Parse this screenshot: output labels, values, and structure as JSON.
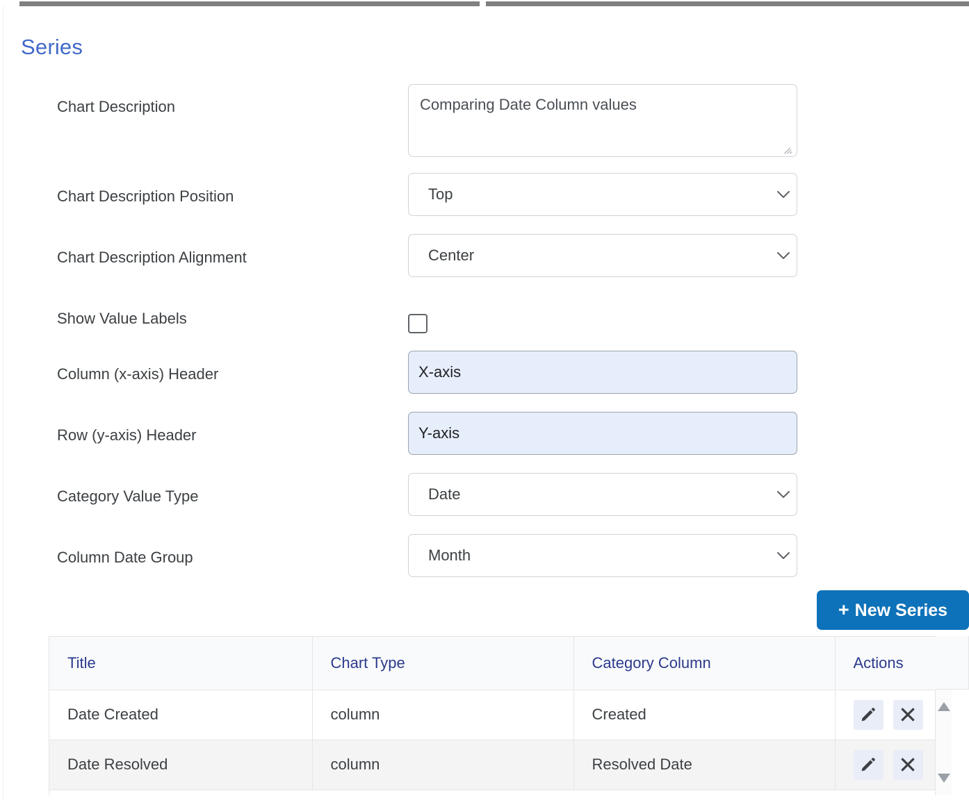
{
  "window": {
    "top_scrollbar": "horizontal-scrollbar"
  },
  "section": {
    "title": "Series",
    "title_color": "#4169c8"
  },
  "form": {
    "rows": [
      {
        "label": "Chart Description",
        "control": "textarea",
        "value": "Comparing Date Column values"
      },
      {
        "label": "Chart Description Position",
        "control": "select",
        "value": "Top"
      },
      {
        "label": "Chart Description Alignment",
        "control": "select",
        "value": "Center"
      },
      {
        "label": "Show Value Labels",
        "control": "checkbox",
        "value": "unchecked"
      },
      {
        "label": "Column (x-axis) Header",
        "control": "text",
        "value": "X-axis"
      },
      {
        "label": "Row (y-axis) Header",
        "control": "text",
        "value": "Y-axis"
      },
      {
        "label": "Category Value Type",
        "control": "select",
        "value": "Date"
      },
      {
        "label": "Column Date Group",
        "control": "select",
        "value": "Month"
      }
    ]
  },
  "toolbar": {
    "new_series_plus": "+",
    "new_series_label": "New Series",
    "new_series_color": "#0d72b9"
  },
  "table": {
    "headers": [
      "Title",
      "Chart Type",
      "Category Column",
      "Actions"
    ],
    "header_color": "#2b3a8c",
    "rows": [
      {
        "title": "Date Created",
        "chart_type": "column",
        "category_column": "Created",
        "edit_label": "edit-icon",
        "delete_label": "delete-icon"
      },
      {
        "title": "Date Resolved",
        "chart_type": "column",
        "category_column": "Resolved Date",
        "edit_label": "edit-icon",
        "delete_label": "delete-icon"
      }
    ],
    "scrollbar": {
      "up": "scroll-up-arrow",
      "down": "scroll-down-arrow"
    }
  }
}
